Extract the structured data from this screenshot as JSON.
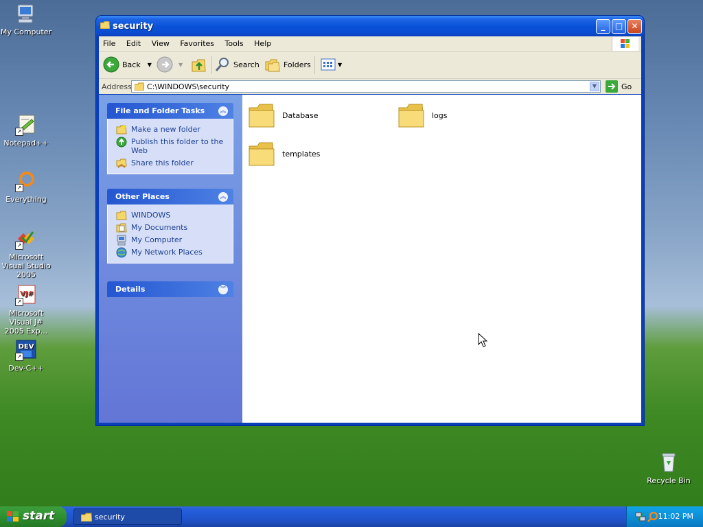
{
  "desktop": {
    "icons": [
      {
        "label": "My Computer"
      },
      {
        "label": "Notepad++"
      },
      {
        "label": "Everything"
      },
      {
        "label": "Microsoft Visual Studio 2005"
      },
      {
        "label": "Microsoft Visual J# 2005 Exp..."
      },
      {
        "label": "Dev-C++"
      },
      {
        "label": "Recycle Bin"
      }
    ],
    "vj_text": "VJ#",
    "dev_text": "DEV"
  },
  "window": {
    "title": "security",
    "menu": [
      "File",
      "Edit",
      "View",
      "Favorites",
      "Tools",
      "Help"
    ],
    "toolbar": {
      "back": "Back",
      "search": "Search",
      "folders": "Folders"
    },
    "address": {
      "label": "Address",
      "value": "C:\\WINDOWS\\security",
      "go": "Go"
    },
    "tasks_panel": {
      "title": "File and Folder Tasks",
      "items": [
        "Make a new folder",
        "Publish this folder to the Web",
        "Share this folder"
      ]
    },
    "other_places": {
      "title": "Other Places",
      "items": [
        "WINDOWS",
        "My Documents",
        "My Computer",
        "My Network Places"
      ]
    },
    "details": {
      "title": "Details"
    },
    "files": [
      {
        "name": "Database",
        "type": "folder"
      },
      {
        "name": "logs",
        "type": "folder"
      },
      {
        "name": "templates",
        "type": "folder"
      }
    ]
  },
  "taskbar": {
    "start": "start",
    "task_button": "security",
    "clock": "11:02 PM"
  },
  "colors": {
    "folder": "#f5d66b",
    "task_link": "#1c3f94",
    "title_bar": "#0a52d8",
    "start": "#2f8f2f"
  }
}
